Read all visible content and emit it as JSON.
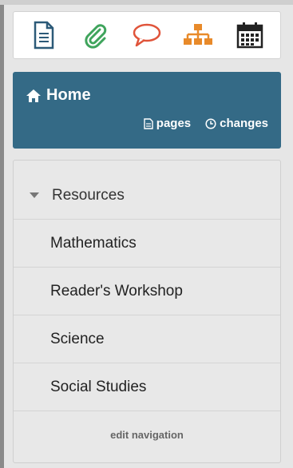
{
  "toolbar": {
    "tools": [
      {
        "icon": "page-icon",
        "color": "#2c5a78"
      },
      {
        "icon": "paperclip-icon",
        "color": "#3fa45c"
      },
      {
        "icon": "comment-icon",
        "color": "#e0543a"
      },
      {
        "icon": "sitemap-icon",
        "color": "#e88a2a"
      },
      {
        "icon": "calendar-icon",
        "color": "#222222"
      }
    ]
  },
  "home": {
    "title": "Home",
    "pages_label": "pages",
    "changes_label": "changes",
    "background": "#346a86"
  },
  "navigation": {
    "section": "Resources",
    "items": [
      "Mathematics",
      "Reader's Workshop",
      "Science",
      "Social Studies"
    ],
    "edit_label": "edit navigation"
  }
}
